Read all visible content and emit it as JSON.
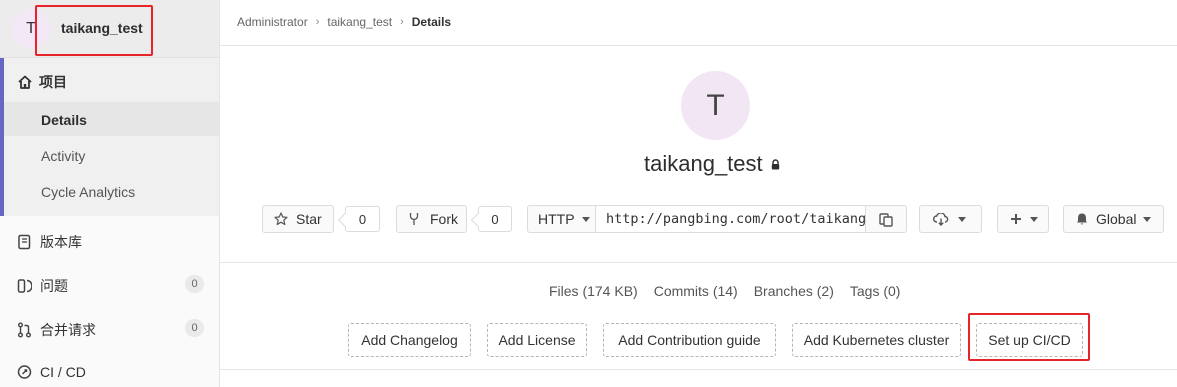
{
  "sidebar": {
    "avatar_letter": "T",
    "project_name": "taikang_test",
    "section_title": "项目",
    "sub_items": [
      {
        "label": "Details"
      },
      {
        "label": "Activity"
      },
      {
        "label": "Cycle Analytics"
      }
    ],
    "items": [
      {
        "label": "版本库",
        "icon": "book-icon"
      },
      {
        "label": "问题",
        "icon": "issues-icon",
        "count": "0"
      },
      {
        "label": "合并请求",
        "icon": "merge-request-icon",
        "count": "0"
      },
      {
        "label": "CI / CD",
        "icon": "rocket-icon"
      }
    ]
  },
  "breadcrumb": [
    "Administrator",
    "taikang_test",
    "Details"
  ],
  "project": {
    "avatar_letter": "T",
    "title": "taikang_test",
    "visibility_icon": "lock-icon"
  },
  "actions": {
    "star_label": "Star",
    "star_count": "0",
    "fork_label": "Fork",
    "fork_count": "0",
    "protocol": "HTTP",
    "clone_url": "http://pangbing.com/root/taikang_test.git",
    "notification_label": "Global"
  },
  "stats": [
    "Files (174 KB)",
    "Commits (14)",
    "Branches (2)",
    "Tags (0)"
  ],
  "quick_links": [
    "Add Changelog",
    "Add License",
    "Add Contribution guide",
    "Add Kubernetes cluster",
    "Set up CI/CD"
  ],
  "colors": {
    "accent": "#6666c4",
    "highlight_box": "#e8242b",
    "avatar_bg": "#f2e6f5"
  }
}
